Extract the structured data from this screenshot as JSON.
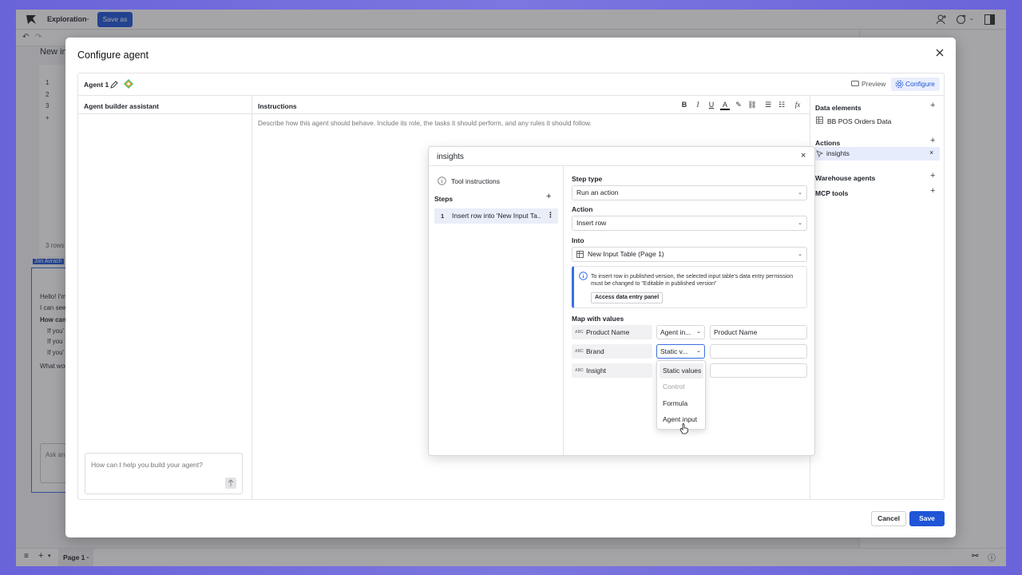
{
  "app": {
    "workbook_title": "Exploration",
    "save_as_label": "Save as",
    "page_tab": "Page 1",
    "bg_title_fragment": "New in",
    "bg_rows": [
      "1",
      "2",
      "3",
      "+"
    ],
    "bg_row_count": "3 rows",
    "bg_author": "Jon Avrach",
    "bg_chat": [
      "Hello! I'm",
      "I can see y",
      "How can",
      "If you'",
      "If you",
      "If you'",
      "What wou"
    ],
    "bg_ask": "Ask any"
  },
  "modal": {
    "title": "Configure agent",
    "agent_name": "Agent 1",
    "preview_label": "Preview",
    "configure_label": "Configure",
    "builder_header": "Agent builder assistant",
    "chat_placeholder": "How can I help you build your agent?",
    "instructions_header": "Instructions",
    "instructions_placeholder": "Describe how this agent should behave. Include its role, the tasks it should perform, and any rules it should follow.",
    "cancel_label": "Cancel",
    "save_label": "Save"
  },
  "right_panel": {
    "data_elements_label": "Data elements",
    "data_element": "BB POS Orders Data",
    "actions_label": "Actions",
    "action_item": "insights",
    "warehouse_label": "Warehouse agents",
    "mcp_label": "MCP tools"
  },
  "popup": {
    "title": "insights",
    "tool_instructions": "Tool instructions",
    "steps_label": "Steps",
    "step_number": "1",
    "step_text": "Insert row into 'New Input Ta...",
    "step_type_label": "Step type",
    "step_type_value": "Run an action",
    "action_label": "Action",
    "action_value": "Insert row",
    "into_label": "Into",
    "into_value": "New Input Table (Page 1)",
    "info_text": "To insert row in published version, the selected input table's data entry permission must be changed to \"Editable in published version\"",
    "info_button": "Access data entry panel",
    "map_label": "Map with values",
    "map_rows": [
      {
        "field": "Product Name",
        "source": "Agent in...",
        "value": "Product Name"
      },
      {
        "field": "Brand",
        "source": "Static v...",
        "value": ""
      },
      {
        "field": "Insight",
        "source": "",
        "value": ""
      }
    ],
    "type_badge": "ABC",
    "dropdown": [
      "Static values",
      "Control",
      "Formula",
      "Agent input"
    ]
  },
  "colors": {
    "accent": "#1f55d6",
    "frame": "#6a63d9"
  }
}
